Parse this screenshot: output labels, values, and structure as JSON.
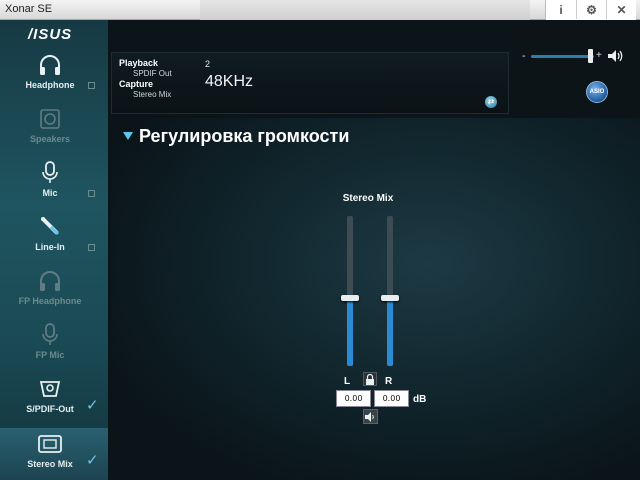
{
  "window": {
    "title": "Xonar SE"
  },
  "titlebar_buttons": [
    "i",
    "⚙",
    "✕"
  ],
  "brand": {
    "logo": "/ISUS"
  },
  "sidebar": {
    "items": [
      {
        "label": "Headphone",
        "icon": "headphone-icon",
        "enabled": true,
        "checked": false
      },
      {
        "label": "Speakers",
        "icon": "speakers-icon",
        "enabled": false,
        "checked": false
      },
      {
        "label": "Mic",
        "icon": "mic-icon",
        "enabled": true,
        "checked": false
      },
      {
        "label": "Line-In",
        "icon": "line-in-icon",
        "enabled": true,
        "checked": false
      },
      {
        "label": "FP Headphone",
        "icon": "fp-headphone-icon",
        "enabled": false,
        "checked": false
      },
      {
        "label": "FP Mic",
        "icon": "fp-mic-icon",
        "enabled": false,
        "checked": false
      },
      {
        "label": "S/PDIF-Out",
        "icon": "spdif-out-icon",
        "enabled": true,
        "checked": true
      },
      {
        "label": "Stereo Mix",
        "icon": "stereo-mix-icon",
        "enabled": true,
        "checked": true,
        "selected": true
      }
    ]
  },
  "info": {
    "playback_label": "Playback",
    "playback_device": "SPDIF Out",
    "capture_label": "Capture",
    "capture_device": "Stereo Mix",
    "channels": "2",
    "sample_rate": "48KHz"
  },
  "master": {
    "minus": "-",
    "plus": "+",
    "level": 0.9
  },
  "asio_label": "ASIO",
  "main": {
    "section_title": "Регулировка громкости",
    "mixer_title": "Stereo Mix",
    "left_label": "L",
    "right_label": "R",
    "left_value": "0.00",
    "right_value": "0.00",
    "unit": "dB",
    "left_level": 0.45,
    "right_level": 0.45
  },
  "colors": {
    "accent": "#2b8ad4",
    "sidebar_bg": "#1f5560",
    "check": "#6fc6e0"
  }
}
